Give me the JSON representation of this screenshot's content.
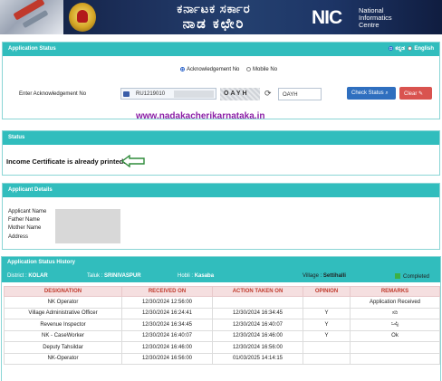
{
  "header": {
    "title_line1": "ಕರ್ನಾಟಕ ಸರ್ಕಾರ",
    "title_line2": "ನಾಡ ಕಛೇರಿ",
    "nic_mark": "NIC",
    "nic_line1": "National",
    "nic_line2": "Informatics",
    "nic_line3": "Centre"
  },
  "app_status": {
    "heading": "Application Status",
    "lang_kannada": "ಕನ್ನಡ",
    "lang_english": "English",
    "option_ack": "Acknowledgement No",
    "option_mobile": "Mobile No",
    "ack_label": "Enter Acknowledgement No",
    "ack_value": "RU1219010",
    "captcha_text": "OAYH",
    "captcha_input": "OAYH",
    "check_button": "Check Status",
    "clear_button": "Clear"
  },
  "watermark": "www.nadakacherikarnataka.in",
  "status": {
    "heading": "Status",
    "message": "Income Certificate is already printed."
  },
  "applicant": {
    "heading": "Applicant Details",
    "fields": [
      "Applicant Name",
      "Father Name",
      "Mother Name",
      "Address"
    ]
  },
  "history": {
    "heading": "Application Status History",
    "district_label": "District :",
    "district_value": "KOLAR",
    "taluk_label": "Taluk :",
    "taluk_value": "SRINIVASPUR",
    "hobli_label": "Hobli :",
    "hobli_value": "Kasaba",
    "village_label": "Village :",
    "village_value": "Settihalli",
    "completed_label": "Completed",
    "columns": [
      "DESIGNATION",
      "RECEIVED ON",
      "ACTION TAKEN ON",
      "OPINION",
      "REMARKS"
    ],
    "rows": [
      [
        "NK Operator",
        "12/30/2024 12:56:00",
        "",
        "",
        "Application Received"
      ],
      [
        "Village Administrative Officer",
        "12/30/2024 16:24:41",
        "12/30/2024 16:34:45",
        "Y",
        "ಸರಿ"
      ],
      [
        "Revenue Inspector",
        "12/30/2024 16:34:45",
        "12/30/2024 16:40:07",
        "Y",
        "ಒಪ್ಪಿ"
      ],
      [
        "NK - CaseWorker",
        "12/30/2024 16:40:07",
        "12/30/2024 16:46:00",
        "Y",
        "Ok"
      ],
      [
        "Deputy Tahsildar",
        "12/30/2024 16:46:00",
        "12/30/2024 16:56:00",
        "",
        ""
      ],
      [
        "NK-Operator",
        "12/30/2024 16:56:00",
        "01/03/2025 14:14:15",
        "",
        ""
      ]
    ]
  }
}
